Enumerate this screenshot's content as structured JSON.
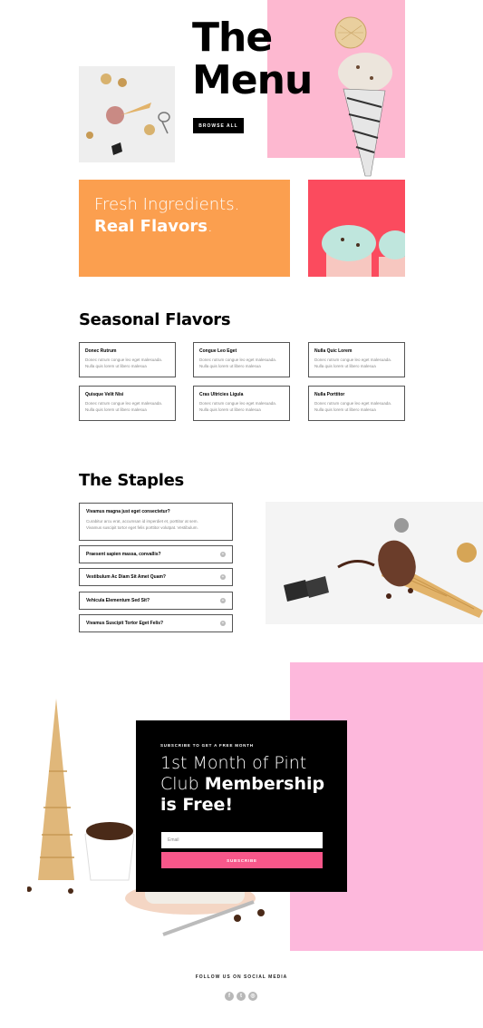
{
  "hero": {
    "title_line1": "The",
    "title_line2": "Menu",
    "browse_label": "BROWSE ALL"
  },
  "fresh": {
    "line1": "Fresh Ingredients.",
    "line2_bold": "Real Flavors",
    "line2_dot": "."
  },
  "seasonal": {
    "heading": "Seasonal Flavors",
    "cards": [
      {
        "title": "Donec Rutrum",
        "body1": "Donec rutrum congue leo eget malesuada.",
        "body2": "Nulla quis lorem ut libero malesua"
      },
      {
        "title": "Congue Leo Eget",
        "body1": "Donec rutrum congue leo eget malesuada.",
        "body2": "Nulla quis lorem ut libero malesua"
      },
      {
        "title": "Nulla Quic Lorem",
        "body1": "Donec rutrum congue leo eget malesuada.",
        "body2": "Nulla quis lorem ut libero malesua"
      },
      {
        "title": "Quisque Velit Nisi",
        "body1": "Donec rutrum congue leo eget malesuada.",
        "body2": "Nulla quis lorem ut libero malesua"
      },
      {
        "title": "Cras Ultricies Ligula",
        "body1": "Donec rutrum congue leo eget malesuada.",
        "body2": "Nulla quis lorem ut libero malesua"
      },
      {
        "title": "Nulla Porttitor",
        "body1": "Donec rutrum congue leo eget malesuada.",
        "body2": "Nulla quis lorem ut libero malesua"
      }
    ]
  },
  "staples": {
    "heading": "The Staples",
    "open_item": {
      "title": "Vivamus magna just eget consectetur?",
      "body1": "Curabitur arcu erat, accumsan id imperdiet et, porttitor at sem.",
      "body2": "Vivamus suscipit tortor eget felis porttitor volutpat. Vestibulum."
    },
    "items": [
      "Praesent sapien massa, convallis?",
      "Vestibulum Ac Diam Sit Amet Quam?",
      "Vehicula Elementum Sed Sit?",
      "Vivamus Suscipit Tortor Eget Felis?"
    ]
  },
  "subscribe": {
    "kicker": "SUBSCRIBE TO GET A FREE MONTH",
    "line1": "1st Month of Pint",
    "line2_light": "Club ",
    "line2_bold": "Membership",
    "line3": "is Free!",
    "email_placeholder": "Email",
    "button_label": "SUBSCRIBE"
  },
  "footer": {
    "follow": "FOLLOW US ON SOCIAL MEDIA",
    "icons": [
      "f",
      "t",
      "◎"
    ]
  },
  "colors": {
    "pink": "#fdb8d0",
    "orange": "#fb9f4f",
    "red": "#fb4b5e",
    "subscribe_button": "#f8578a"
  }
}
